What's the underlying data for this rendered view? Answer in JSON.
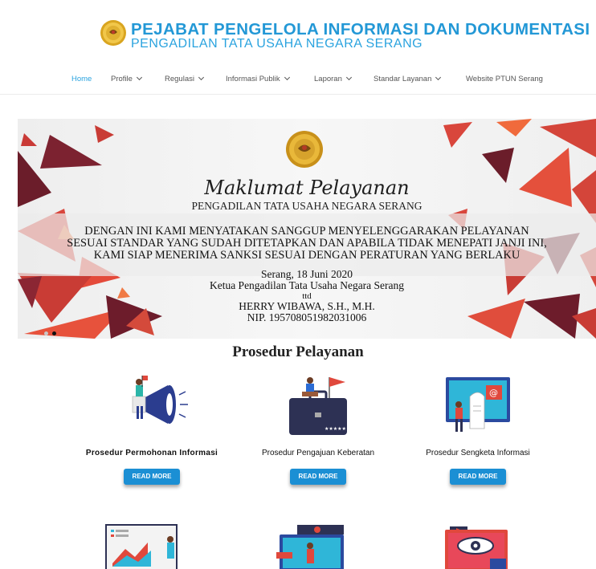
{
  "header": {
    "title": "PEJABAT PENGELOLA INFORMASI DAN DOKUMENTASI",
    "subtitle": "PENGADILAN TATA USAHA NEGARA SERANG"
  },
  "nav": [
    {
      "label": "Home",
      "dropdown": false,
      "active": true
    },
    {
      "label": "Profile",
      "dropdown": true,
      "active": false
    },
    {
      "label": "Regulasi",
      "dropdown": true,
      "active": false
    },
    {
      "label": "Informasi Publik",
      "dropdown": true,
      "active": false
    },
    {
      "label": "Laporan",
      "dropdown": true,
      "active": false
    },
    {
      "label": "Standar Layanan",
      "dropdown": true,
      "active": false
    },
    {
      "label": "Website PTUN Serang",
      "dropdown": false,
      "active": false
    }
  ],
  "banner": {
    "title": "Maklumat Pelayanan",
    "court": "PENGADILAN TATA USAHA NEGARA SERANG",
    "statement": [
      "DENGAN INI KAMI MENYATAKAN SANGGUP MENYELENGGARAKAN PELAYANAN",
      "SESUAI STANDAR YANG SUDAH DITETAPKAN DAN APABILA TIDAK MENEPATI JANJI INI,",
      "KAMI SIAP MENERIMA SANKSI SESUAI DENGAN PERATURAN YANG BERLAKU"
    ],
    "place_date": "Serang, 18 Juni 2020",
    "position": "Ketua Pengadilan Tata Usaha Negara Serang",
    "ttd": "ttd",
    "name": "HERRY WIBAWA, S.H., M.H.",
    "nip": "NIP. 195708051982031006",
    "slides": 2,
    "active_slide": 1
  },
  "section": {
    "title": "Prosedur Pelayanan",
    "cards": [
      {
        "title": "Prosedur Permohonan Informasi",
        "button": "READ MORE",
        "icon": "megaphone-illustration"
      },
      {
        "title": "Prosedur Pengajuan Keberatan",
        "button": "READ MORE",
        "icon": "briefcase-illustration"
      },
      {
        "title": "Prosedur Sengketa Informasi",
        "button": "READ MORE",
        "icon": "monitor-email-illustration"
      }
    ],
    "row2_icons": [
      "presentation-chart-illustration",
      "monitor-marketing-illustration",
      "monitor-eye-illustration"
    ]
  },
  "colors": {
    "brand": "#2398d6",
    "button": "#1b8fd4",
    "nav_active": "#2aa3df",
    "triangle_dark": "#6b1d2a",
    "triangle_red": "#d4453a",
    "triangle_orange": "#f06a3c"
  }
}
